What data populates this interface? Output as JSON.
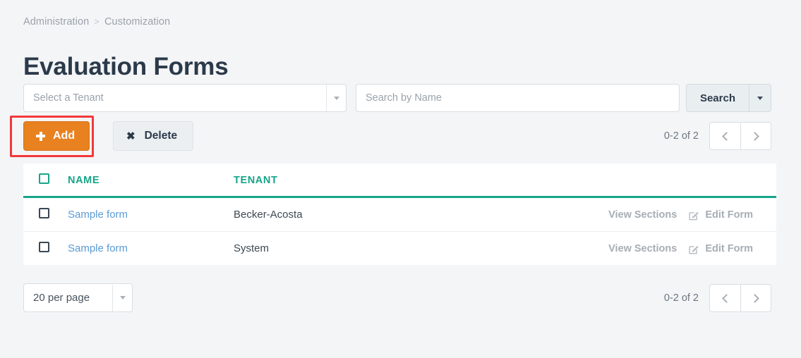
{
  "breadcrumb": {
    "items": [
      "Administration",
      "Customization"
    ],
    "separator": ">"
  },
  "page_title": "Evaluation Forms",
  "filters": {
    "tenant_select": {
      "placeholder": "Select a Tenant",
      "value": "",
      "caret_icon": "chevron-down-icon"
    },
    "search_field": {
      "placeholder": "Search by Name",
      "value": ""
    },
    "search_button": {
      "label": "Search",
      "caret_icon": "chevron-down-icon"
    }
  },
  "toolbar": {
    "add_label": "Add",
    "add_icon": "plus-icon",
    "delete_label": "Delete",
    "delete_icon": "close-x-icon"
  },
  "pagination_top": {
    "range_text": "0-2 of 2",
    "prev_icon": "chevron-left-icon",
    "next_icon": "chevron-right-icon"
  },
  "table": {
    "columns": [
      "NAME",
      "TENANT"
    ],
    "select_all_checkbox": "checkbox-unchecked",
    "rows": [
      {
        "name": "Sample form",
        "tenant": "Becker-Acosta",
        "view_sections_label": "View Sections",
        "edit_form_label": "Edit Form",
        "edit_icon": "edit-pencil-square-icon",
        "checkbox": "checkbox-unchecked"
      },
      {
        "name": "Sample form",
        "tenant": "System",
        "view_sections_label": "View Sections",
        "edit_form_label": "Edit Form",
        "edit_icon": "edit-pencil-square-icon",
        "checkbox": "checkbox-unchecked"
      }
    ]
  },
  "footer": {
    "per_page": {
      "value": "20 per page",
      "caret_icon": "chevron-down-icon"
    },
    "range_text": "0-2 of 2",
    "prev_icon": "chevron-left-icon",
    "next_icon": "chevron-right-icon"
  },
  "annotation": {
    "highlight_color": "#f2383a",
    "target": "add-button"
  },
  "colors": {
    "accent_teal": "#17a589",
    "primary_orange": "#e8811f",
    "link_blue": "#5b9bd5",
    "title_navy": "#2b3a4a",
    "page_background": "#f4f5f7"
  }
}
